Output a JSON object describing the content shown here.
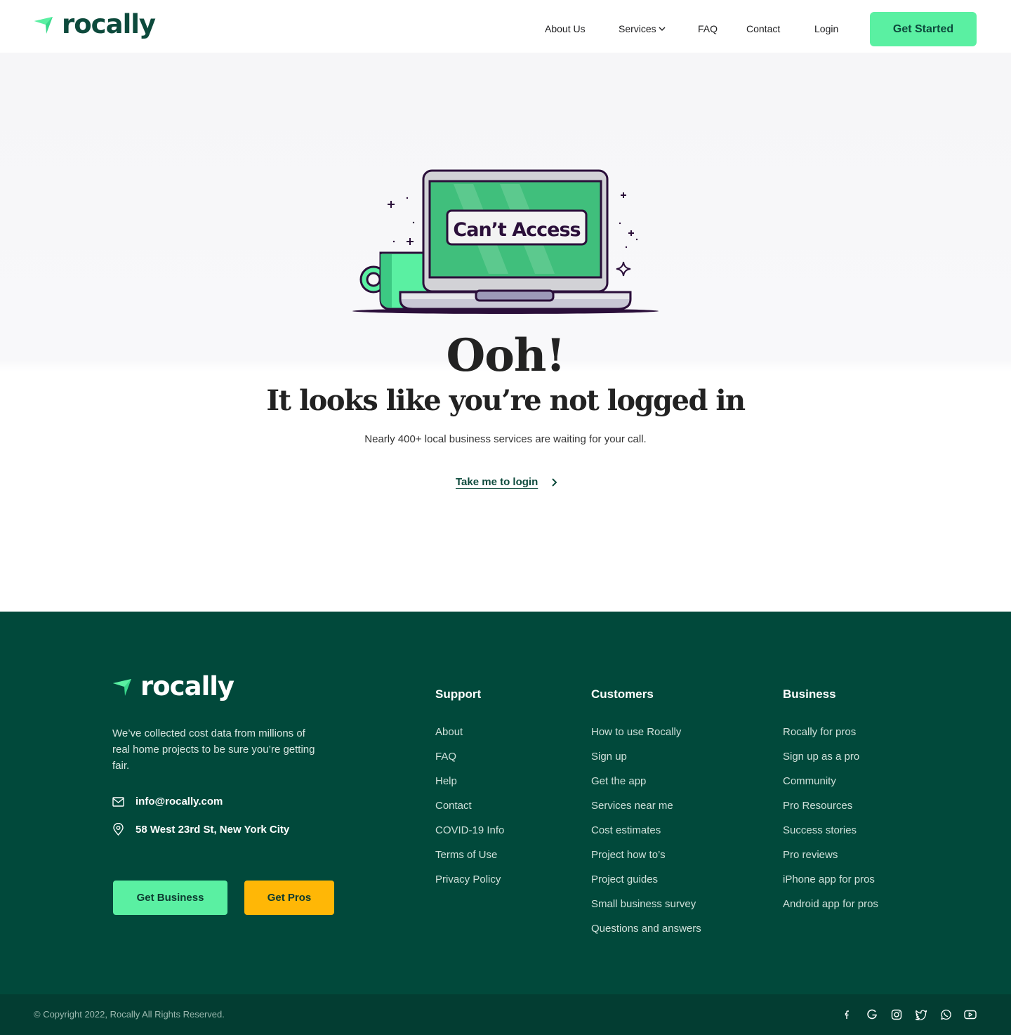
{
  "header": {
    "logo_text": "rocally",
    "nav": [
      {
        "label": "About Us"
      },
      {
        "label": "Services"
      },
      {
        "label": "FAQ"
      },
      {
        "label": "Contact"
      },
      {
        "label": "Login"
      }
    ],
    "cta_label": "Get Started"
  },
  "hero": {
    "illustration_text": "Can’t Access",
    "title": "Ooh!",
    "subtitle": "It looks like you’re not logged in",
    "description": "Nearly 400+ local business services are waiting for your call.",
    "login_link": "Take me to login"
  },
  "footer": {
    "logo_text": "rocally",
    "about": "We’ve collected cost data from millions of real home projects to be sure you’re getting fair.",
    "email": "info@rocally.com",
    "address": "58 West 23rd St, New York City",
    "buttons": {
      "business": "Get Business",
      "pros": "Get Pros"
    },
    "columns": [
      {
        "title": "Support",
        "links": [
          "About",
          "FAQ",
          "Help",
          "Contact",
          "COVID-19 Info",
          "Terms of Use",
          "Privacy Policy"
        ]
      },
      {
        "title": "Customers",
        "links": [
          "How to use Rocally",
          "Sign up",
          "Get the app",
          "Services near me",
          "Cost estimates",
          "Project how to’s",
          "Project guides",
          "Small business survey",
          "Questions and answers"
        ]
      },
      {
        "title": "Business",
        "links": [
          "Rocally for pros",
          "Sign up as a pro",
          "Community",
          "Pro Resources",
          "Success stories",
          "Pro reviews",
          "iPhone app for pros",
          "Android app for pros"
        ]
      }
    ],
    "copyright": "© Copyright 2022, Rocally All Rights Reserved.",
    "socials": [
      "facebook-icon",
      "google-icon",
      "instagram-icon",
      "twitter-icon",
      "whatsapp-icon",
      "youtube-icon"
    ]
  },
  "colors": {
    "brand_dark": "#0d4a3c",
    "accent_green": "#5af0a2",
    "footer_bg": "#01493b",
    "accent_yellow": "#ffb706"
  }
}
